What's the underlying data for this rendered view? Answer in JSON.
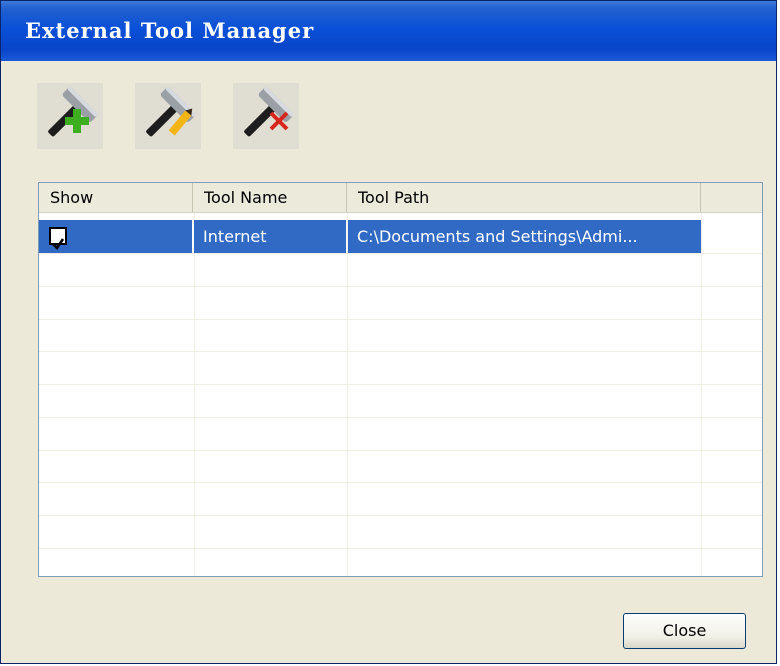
{
  "window": {
    "title": "External Tool Manager"
  },
  "toolbar": {
    "buttons": [
      {
        "name": "add-tool",
        "icon": "hammer-plus-icon"
      },
      {
        "name": "edit-tool",
        "icon": "hammer-pencil-icon"
      },
      {
        "name": "delete-tool",
        "icon": "hammer-delete-icon"
      }
    ]
  },
  "grid": {
    "columns": [
      "Show",
      "Tool Name",
      "Tool Path"
    ],
    "rows": [
      {
        "show": true,
        "name": "Internet",
        "path": "C:\\Documents and Settings\\Admi..."
      }
    ]
  },
  "footer": {
    "close_label": "Close"
  },
  "colors": {
    "titlebar": "#0a50d8",
    "selection": "#316ac5",
    "window_bg": "#ece9d8"
  }
}
